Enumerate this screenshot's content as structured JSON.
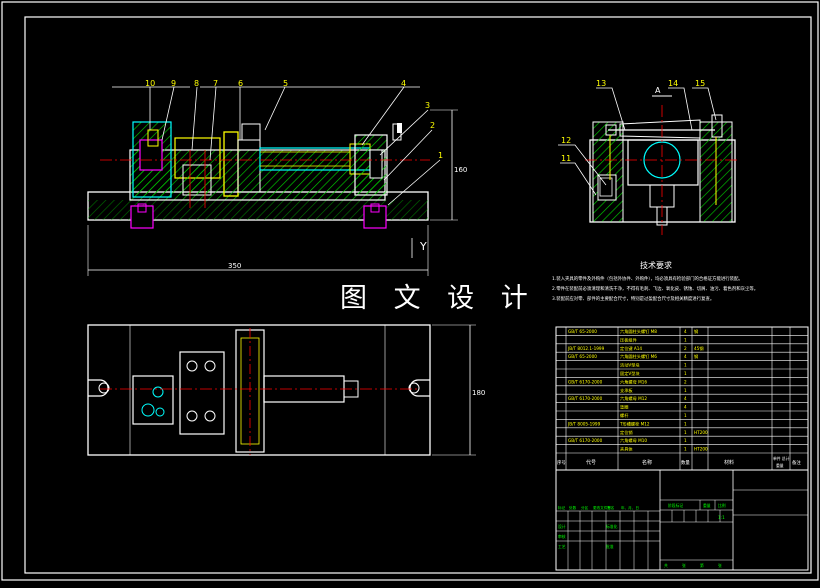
{
  "watermark": "图 文 设 计",
  "section_marker": "A",
  "view_marker": "Y",
  "dimensions": {
    "front_length": "350",
    "front_height": "160",
    "plan_width": "180"
  },
  "part_callouts": {
    "front": [
      "10",
      "9",
      "8",
      "7",
      "6",
      "5",
      "4",
      "3",
      "2",
      "1"
    ],
    "side": [
      "13",
      "14",
      "15",
      "12",
      "11"
    ]
  },
  "notes": {
    "title": "技术要求",
    "lines": [
      "1.装入夹具的零件及外购件（包括外协件、外购件），均必须具有检验部门的合格证方能进行装配。",
      "2.零件在装配前必须清理和清洗干净，不得有毛刺、飞边、氧化皮、锈蚀、切屑、油污、着色剂和灰尘等。",
      "3.装配前应对零、部件的主要配合尺寸，特别是过盈配合尺寸及相关精度进行复查。"
    ]
  },
  "bom": {
    "rows": [
      {
        "no": "",
        "code": "GB/T 65-2000",
        "name": "六角圆柱头螺钉 M8",
        "qty": "4",
        "mat": "钢"
      },
      {
        "no": "",
        "code": "",
        "name": "压板组件",
        "qty": "1",
        "mat": ""
      },
      {
        "no": "",
        "code": "JB/T 8012.1-1999",
        "name": "定位键 A14",
        "qty": "2",
        "mat": "45钢"
      },
      {
        "no": "",
        "code": "GB/T 65-2000",
        "name": "六角圆柱头螺钉 M6",
        "qty": "4",
        "mat": "钢"
      },
      {
        "no": "",
        "code": "",
        "name": "活动V型块",
        "qty": "1",
        "mat": ""
      },
      {
        "no": "",
        "code": "",
        "name": "固定V型块",
        "qty": "1",
        "mat": ""
      },
      {
        "no": "",
        "code": "GB/T 6170-2000",
        "name": "六角螺母 M16",
        "qty": "2",
        "mat": ""
      },
      {
        "no": "",
        "code": "",
        "name": "支承板",
        "qty": "1",
        "mat": ""
      },
      {
        "no": "",
        "code": "GB/T 6170-2000",
        "name": "六角螺母 M12",
        "qty": "4",
        "mat": ""
      },
      {
        "no": "",
        "code": "",
        "name": "垫圈",
        "qty": "4",
        "mat": ""
      },
      {
        "no": "",
        "code": "",
        "name": "螺杆",
        "qty": "1",
        "mat": ""
      },
      {
        "no": "",
        "code": "JB/T 8005-1999",
        "name": "T形槽螺栓 M12",
        "qty": "1",
        "mat": ""
      },
      {
        "no": "",
        "code": "",
        "name": "定位销",
        "qty": "1",
        "mat": "HT200"
      },
      {
        "no": "",
        "code": "GB/T 6170-2000",
        "name": "六角螺母 M10",
        "qty": "1",
        "mat": ""
      },
      {
        "no": "",
        "code": "",
        "name": "夹具体",
        "qty": "1",
        "mat": "HT200"
      }
    ],
    "header": {
      "no": "序号",
      "code": "代号",
      "name": "名称",
      "qty": "数量",
      "mat": "材料",
      "wt": "单件 总计",
      "wt_sub": "重量",
      "remark": "备注"
    }
  },
  "titleblock": {
    "row1": [
      "标记",
      "处数",
      "分区",
      "更改文件号",
      "签名",
      "年、月、日"
    ],
    "row2": [
      "设计",
      "标准化"
    ],
    "row3": [
      "审核"
    ],
    "row4": [
      "工艺",
      "批准"
    ],
    "stage": [
      "阶段标记",
      "重量",
      "比例"
    ],
    "scale": "1:1",
    "sheet": [
      "共",
      "张",
      "第",
      "张"
    ]
  },
  "colors": {
    "background": "#000000",
    "outline": "#ffffff",
    "part": "#00ffff",
    "hatch": "#00e000",
    "threads": "#ffff00",
    "center": "#ff0000",
    "label": "#ffff00",
    "note": "#ffffff",
    "table_text": "#ffff00"
  }
}
